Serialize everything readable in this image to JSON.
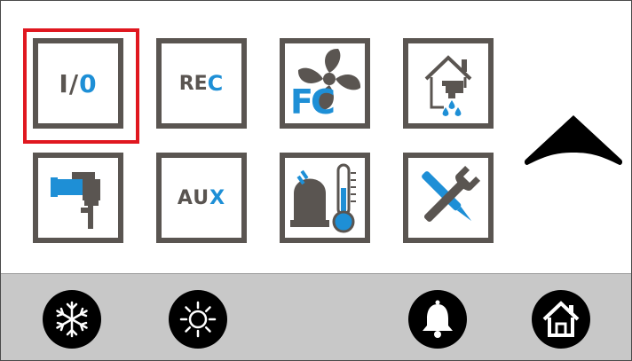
{
  "menu": {
    "tiles": [
      {
        "id": "io",
        "label_a": "I/",
        "label_b": "0"
      },
      {
        "id": "rec",
        "label_a": "REC",
        "label_b": ""
      },
      {
        "id": "fc",
        "label_a": "FC",
        "label_b": ""
      },
      {
        "id": "water",
        "label_a": "",
        "label_b": ""
      },
      {
        "id": "valve",
        "label_a": "",
        "label_b": ""
      },
      {
        "id": "aux",
        "label_a": "AU",
        "label_b": "X"
      },
      {
        "id": "temp",
        "label_a": "",
        "label_b": ""
      },
      {
        "id": "tools",
        "label_a": "",
        "label_b": ""
      }
    ],
    "selected": "io"
  },
  "colors": {
    "accent_blue": "#1e8fd6",
    "tile_border": "#5a5551",
    "selection_red": "#e0171f",
    "bottom_bar": "#c8c8c8"
  },
  "bottom_bar": {
    "buttons": [
      "snowflake-icon",
      "sun-icon",
      "bell-icon",
      "home-icon"
    ]
  }
}
